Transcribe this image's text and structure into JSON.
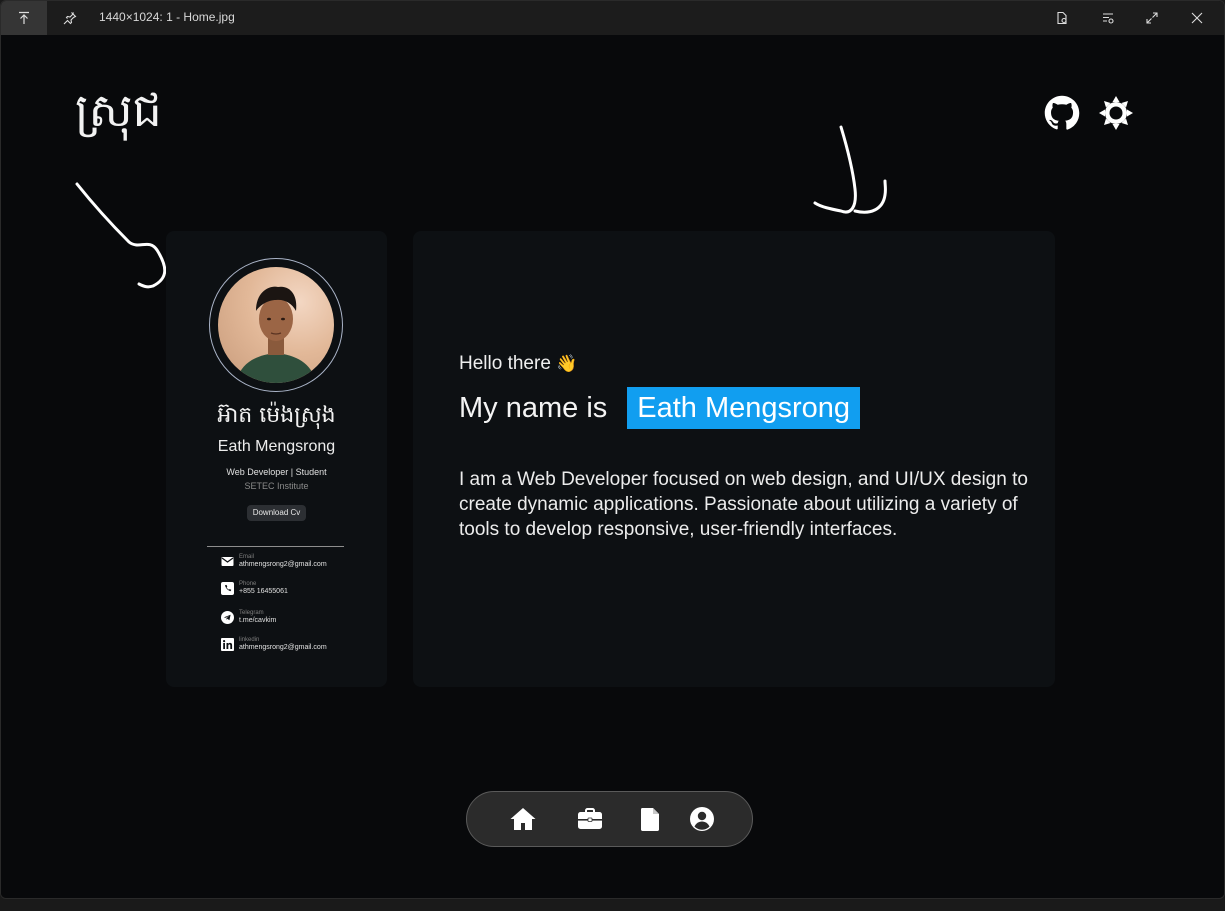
{
  "window": {
    "title": "1440×1024: 1 - Home.jpg"
  },
  "brand": {
    "text": "ស្រុជ"
  },
  "profile": {
    "name_khmer": "អ៊ាត ម៉េងស្រុង",
    "name_en": "Eath Mengsrong",
    "role": "Web Developer | Student",
    "school": "SETEC Institute",
    "download_label": "Download Cv",
    "contacts": [
      {
        "label": "Email",
        "value": "athmengsrong2@gmail.com",
        "icon": "envelope-icon"
      },
      {
        "label": "Phone",
        "value": "+855 16455061",
        "icon": "phone-icon"
      },
      {
        "label": "Telegram",
        "value": "t.me/cavkim",
        "icon": "telegram-icon"
      },
      {
        "label": "linkedin",
        "value": "athmengsrong2@gmail.com",
        "icon": "linkedin-icon"
      }
    ]
  },
  "hero": {
    "greeting": "Hello there",
    "greeting_emoji": "👋",
    "name_prefix": "My name is",
    "name_highlight": "Eath Mengsrong",
    "bio": "I am a Web Developer  focused on web design, and UI/UX design to create dynamic applications. Passionate about utilizing a variety of tools to develop responsive, user-friendly interfaces."
  },
  "nav": {
    "items": [
      {
        "name": "home",
        "icon": "home-icon"
      },
      {
        "name": "portfolio",
        "icon": "briefcase-icon"
      },
      {
        "name": "resume",
        "icon": "document-icon"
      },
      {
        "name": "about",
        "icon": "user-circle-icon"
      }
    ]
  },
  "colors": {
    "background": "#08090b",
    "card": "#0d1013",
    "accent": "#119ef0",
    "nav_bg": "#2b2b2b"
  }
}
